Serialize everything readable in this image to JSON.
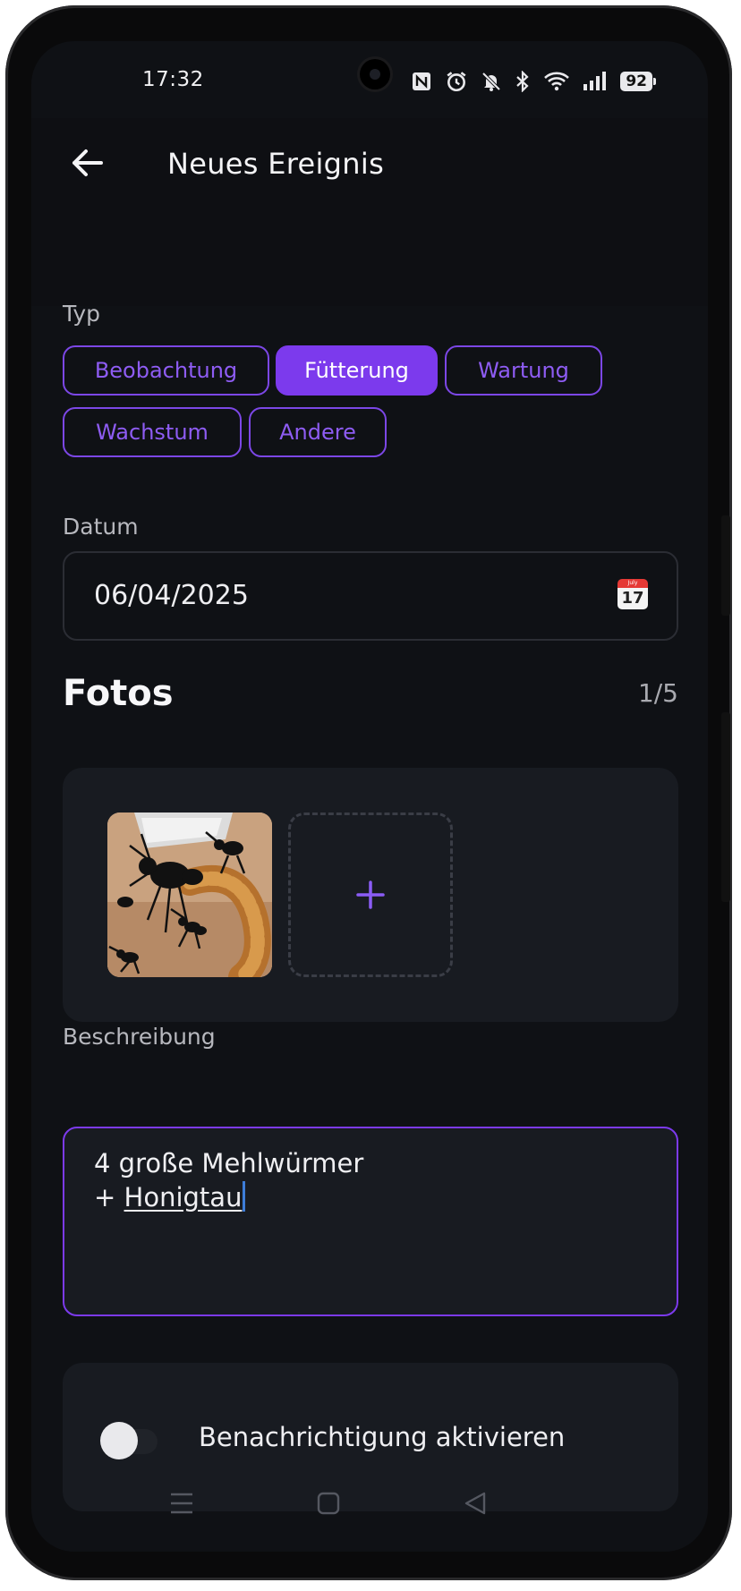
{
  "status_bar": {
    "time": "17:32",
    "battery": "92",
    "icons": [
      "nfc-icon",
      "alarm-icon",
      "bell-off-icon",
      "bluetooth-icon",
      "wifi-icon",
      "signal-icon",
      "battery-icon"
    ]
  },
  "header": {
    "title": "Neues Ereignis",
    "back_icon": "arrow-left-icon"
  },
  "type_section": {
    "label": "Typ",
    "chips": [
      {
        "label": "Beobachtung",
        "selected": false
      },
      {
        "label": "Fütterung",
        "selected": true
      },
      {
        "label": "Wartung",
        "selected": false
      },
      {
        "label": "Wachstum",
        "selected": false
      },
      {
        "label": "Andere",
        "selected": false
      }
    ]
  },
  "date_section": {
    "label": "Datum",
    "value": "06/04/2025",
    "icon": "calendar-icon",
    "calendar_icon_text": {
      "month": "July",
      "day": "17"
    }
  },
  "photos_section": {
    "title": "Fotos",
    "count": "1/5",
    "add_icon": "plus-icon"
  },
  "description_section": {
    "label": "Beschreibung",
    "line1": "4 große Mehlwürmer",
    "line2_prefix": "+ ",
    "line2_word": "Honigtau"
  },
  "notification": {
    "label": "Benachrichtigung aktivieren",
    "enabled": false
  },
  "colors": {
    "accent": "#7c3aed",
    "background": "#0f1115",
    "card": "#181b21"
  },
  "nav_bar": {
    "icons": [
      "menu-icon",
      "home-square-icon",
      "back-triangle-icon"
    ]
  }
}
